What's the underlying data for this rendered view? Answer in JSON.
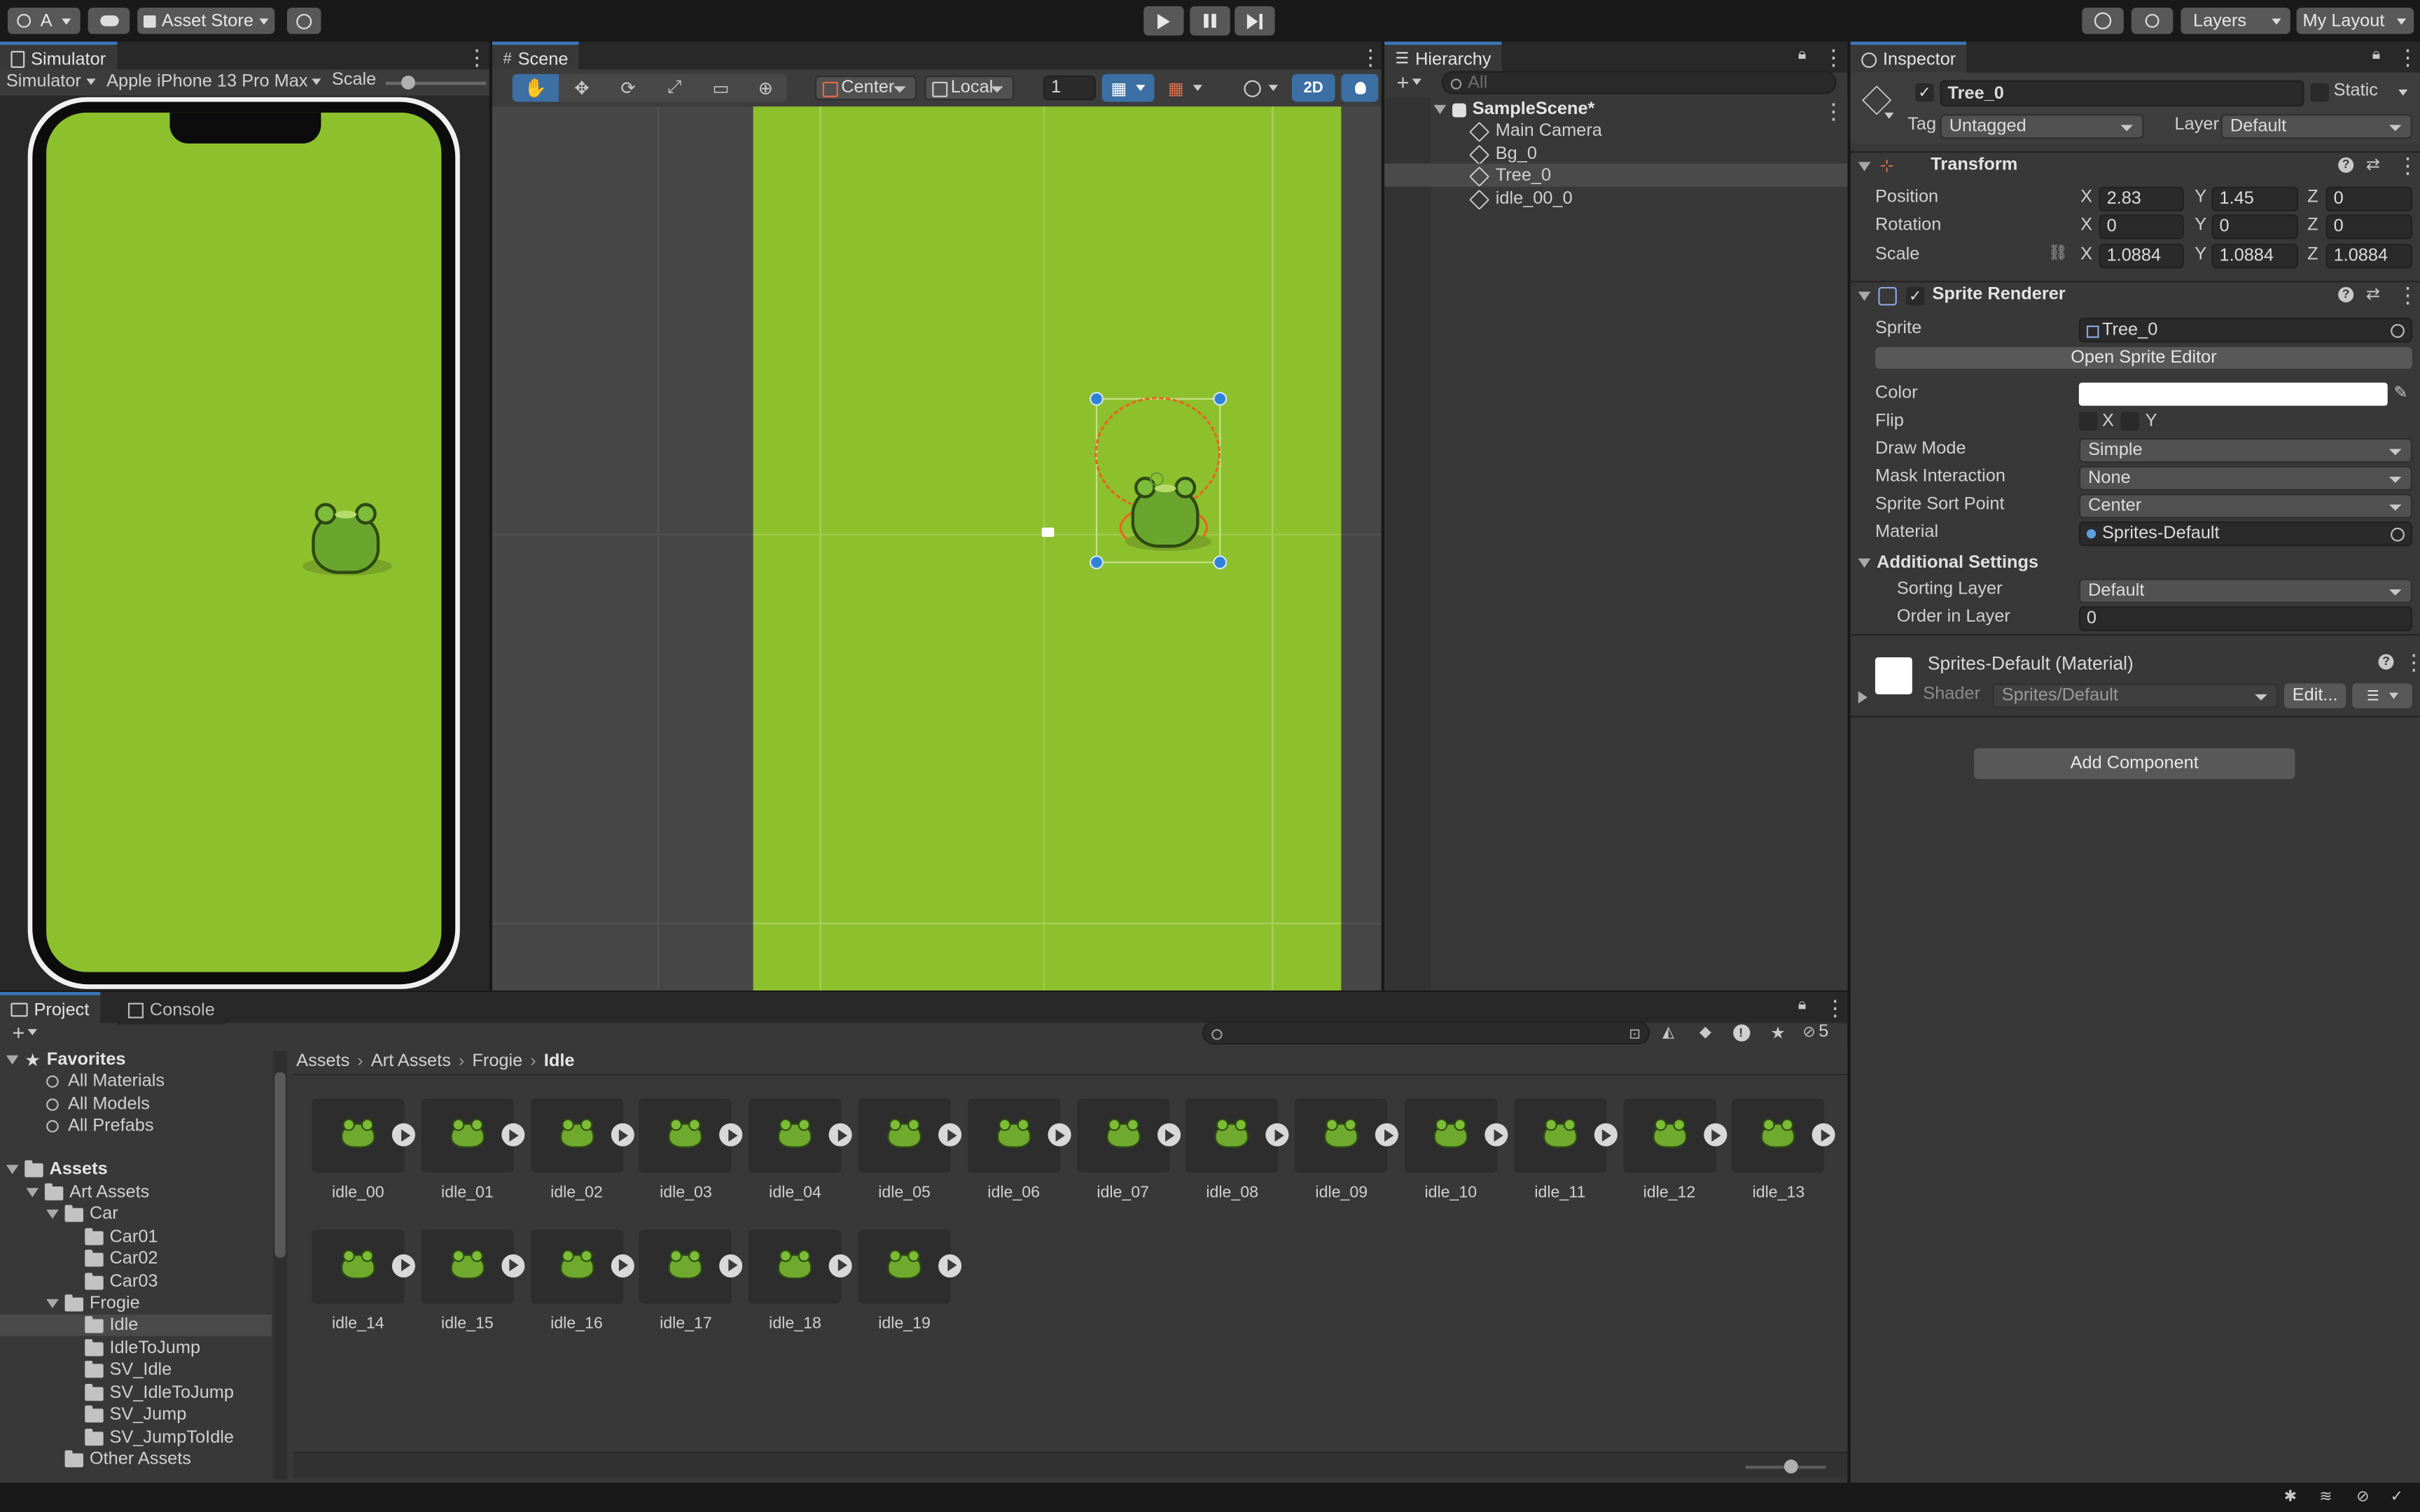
{
  "toolbar": {
    "account": "A",
    "asset_store": "Asset Store",
    "layers": "Layers",
    "layout": "My Layout"
  },
  "simulator": {
    "tab": "Simulator",
    "mode": "Simulator",
    "device": "Apple iPhone 13 Pro Max",
    "scale_label": "Scale"
  },
  "scene": {
    "tab": "Scene",
    "pivot": "Center",
    "space": "Local",
    "snap_value": "1",
    "mode_2d": "2D"
  },
  "hierarchy": {
    "tab": "Hierarchy",
    "search_placeholder": "All",
    "scene_name": "SampleScene*",
    "items": [
      "Main Camera",
      "Bg_0",
      "Tree_0",
      "idle_00_0"
    ],
    "selected": "Tree_0"
  },
  "inspector": {
    "tab": "Inspector",
    "object_name": "Tree_0",
    "static_label": "Static",
    "tag_label": "Tag",
    "tag_value": "Untagged",
    "layer_label": "Layer",
    "layer_value": "Default",
    "transform": {
      "title": "Transform",
      "position_label": "Position",
      "rotation_label": "Rotation",
      "scale_label": "Scale",
      "position": {
        "x": "2.83",
        "y": "1.45",
        "z": "0"
      },
      "rotation": {
        "x": "0",
        "y": "0",
        "z": "0"
      },
      "scale": {
        "x": "1.0884",
        "y": "1.0884",
        "z": "1.0884"
      },
      "axis_x": "X",
      "axis_y": "Y",
      "axis_z": "Z"
    },
    "sprite_renderer": {
      "title": "Sprite Renderer",
      "sprite_label": "Sprite",
      "sprite_value": "Tree_0",
      "open_editor": "Open Sprite Editor",
      "color_label": "Color",
      "color_value": "#ffffff",
      "flip_label": "Flip",
      "flip_x": "X",
      "flip_y": "Y",
      "draw_mode_label": "Draw Mode",
      "draw_mode_value": "Simple",
      "mask_label": "Mask Interaction",
      "mask_value": "None",
      "sort_point_label": "Sprite Sort Point",
      "sort_point_value": "Center",
      "material_label": "Material",
      "material_value": "Sprites-Default",
      "additional_settings": "Additional Settings",
      "sorting_layer_label": "Sorting Layer",
      "sorting_layer_value": "Default",
      "order_label": "Order in Layer",
      "order_value": "0"
    },
    "material": {
      "title": "Sprites-Default (Material)",
      "shader_label": "Shader",
      "shader_value": "Sprites/Default",
      "edit_button": "Edit..."
    },
    "add_component": "Add Component"
  },
  "project": {
    "tab_project": "Project",
    "tab_console": "Console",
    "hidden_count": "5",
    "breadcrumb": [
      "Assets",
      "Art Assets",
      "Frogie",
      "Idle"
    ],
    "tree": [
      {
        "label": "Favorites",
        "level": 0,
        "kind": "header"
      },
      {
        "label": "All Materials",
        "level": 1,
        "kind": "search"
      },
      {
        "label": "All Models",
        "level": 1,
        "kind": "search"
      },
      {
        "label": "All Prefabs",
        "level": 1,
        "kind": "search"
      },
      {
        "label": "Assets",
        "level": 0,
        "kind": "root"
      },
      {
        "label": "Art Assets",
        "level": 1,
        "kind": "folder-open"
      },
      {
        "label": "Car",
        "level": 2,
        "kind": "folder-open"
      },
      {
        "label": "Car01",
        "level": 3,
        "kind": "folder"
      },
      {
        "label": "Car02",
        "level": 3,
        "kind": "folder"
      },
      {
        "label": "Car03",
        "level": 3,
        "kind": "folder"
      },
      {
        "label": "Frogie",
        "level": 2,
        "kind": "folder-open"
      },
      {
        "label": "Idle",
        "level": 3,
        "kind": "folder",
        "selected": true
      },
      {
        "label": "IdleToJump",
        "level": 3,
        "kind": "folder"
      },
      {
        "label": "SV_Idle",
        "level": 3,
        "kind": "folder"
      },
      {
        "label": "SV_IdleToJump",
        "level": 3,
        "kind": "folder"
      },
      {
        "label": "SV_Jump",
        "level": 3,
        "kind": "folder"
      },
      {
        "label": "SV_JumpToIdle",
        "level": 3,
        "kind": "folder"
      },
      {
        "label": "Other Assets",
        "level": 2,
        "kind": "folder"
      }
    ],
    "assets": [
      "idle_00",
      "idle_01",
      "idle_02",
      "idle_03",
      "idle_04",
      "idle_05",
      "idle_06",
      "idle_07",
      "idle_08",
      "idle_09",
      "idle_10",
      "idle_11",
      "idle_12",
      "idle_13",
      "idle_14",
      "idle_15",
      "idle_16",
      "idle_17",
      "idle_18",
      "idle_19"
    ]
  },
  "colors": {
    "accent": "#3a79bb",
    "scene_green": "#8dc02d",
    "selection_orange": "#e8661c",
    "handle_blue": "#2f82d8"
  }
}
